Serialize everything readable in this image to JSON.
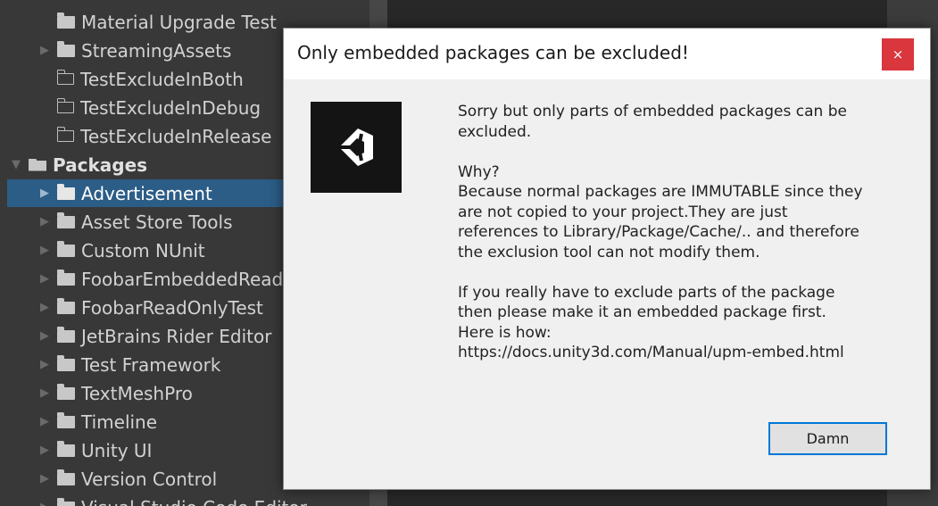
{
  "project_tree": {
    "items": [
      {
        "label": "Material Upgrade Test",
        "arrow": "",
        "folder": "filled"
      },
      {
        "label": "StreamingAssets",
        "arrow": "▶",
        "folder": "filled"
      },
      {
        "label": "TestExcludeInBoth",
        "arrow": "",
        "folder": "outline"
      },
      {
        "label": "TestExcludeInDebug",
        "arrow": "",
        "folder": "outline"
      },
      {
        "label": "TestExcludeInRelease",
        "arrow": "",
        "folder": "outline"
      },
      {
        "label": "Packages",
        "arrow": "▼",
        "folder": "open",
        "header": true
      },
      {
        "label": "Advertisement",
        "arrow": "▶",
        "folder": "filled",
        "selected": true
      },
      {
        "label": "Asset Store Tools",
        "arrow": "▶",
        "folder": "filled"
      },
      {
        "label": "Custom NUnit",
        "arrow": "▶",
        "folder": "filled"
      },
      {
        "label": "FoobarEmbeddedReadOnly",
        "arrow": "▶",
        "folder": "filled"
      },
      {
        "label": "FoobarReadOnlyTest",
        "arrow": "▶",
        "folder": "filled"
      },
      {
        "label": "JetBrains Rider Editor",
        "arrow": "▶",
        "folder": "filled"
      },
      {
        "label": "Test Framework",
        "arrow": "▶",
        "folder": "filled"
      },
      {
        "label": "TextMeshPro",
        "arrow": "▶",
        "folder": "filled"
      },
      {
        "label": "Timeline",
        "arrow": "▶",
        "folder": "filled"
      },
      {
        "label": "Unity UI",
        "arrow": "▶",
        "folder": "filled"
      },
      {
        "label": "Version Control",
        "arrow": "▶",
        "folder": "filled"
      },
      {
        "label": "Visual Studio Code Editor",
        "arrow": "▶",
        "folder": "filled"
      }
    ]
  },
  "dialog": {
    "title": "Only embedded packages can be excluded!",
    "close_icon": "×",
    "logo_icon": "unity-logo-icon",
    "message": {
      "p1": [
        "Sorry but only parts of embedded packages can be",
        "excluded."
      ],
      "p2": [
        "Why?",
        "Because normal packages are IMMUTABLE since they",
        "are not copied to your project.They are just",
        "references to Library/Package/Cache/.. and therefore",
        "the exclusion tool can not modify them."
      ],
      "p3": [
        "If you really have to exclude parts of the package",
        "then please make it an embedded package first.",
        "Here is how:",
        "https://docs.unity3d.com/Manual/upm-embed.html"
      ]
    },
    "button_label": "Damn"
  },
  "colors": {
    "editor_background": "#383838",
    "selection": "#2c5d87",
    "close_button": "#d9363e",
    "button_focus_border": "#0078d7"
  }
}
